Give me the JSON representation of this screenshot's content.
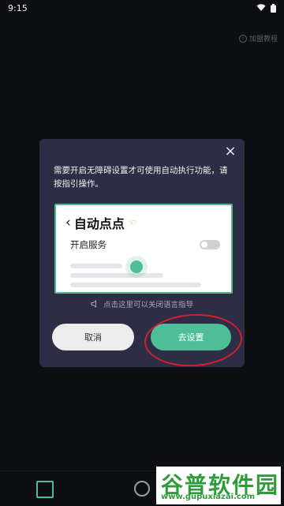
{
  "status_bar": {
    "time": "9:15"
  },
  "top_link": {
    "label": "加盟教程"
  },
  "dialog": {
    "message": "需要开启无障碍设置才可使用自动执行功能，请按指引操作。",
    "preview": {
      "title": "自动点点",
      "service_label": "开启服务"
    },
    "voice_hint": "点击这里可以关闭语言指导",
    "buttons": {
      "cancel": "取消",
      "setup": "去设置"
    }
  },
  "watermark": {
    "brand": "谷普软件园",
    "url": "www.gupuxiazai.com"
  },
  "colors": {
    "accent": "#4fbe98",
    "dialog_bg": "#2d2d45",
    "highlight": "#d21f2f"
  },
  "icons": [
    "wifi-icon",
    "battery-icon",
    "close-icon",
    "back-chevron-icon",
    "hand-icon",
    "speaker-icon"
  ]
}
